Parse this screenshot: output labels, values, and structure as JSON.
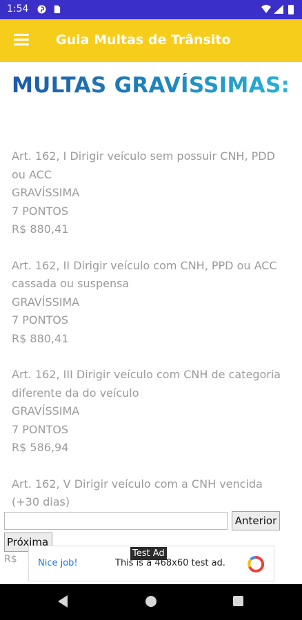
{
  "status_bar": {
    "time": "1:54",
    "icons": [
      "pinterest-icon",
      "sim-card-icon",
      "wifi-icon",
      "signal-icon",
      "battery-icon"
    ]
  },
  "app_bar": {
    "title": "Guia Multas de Trânsito",
    "menu_icon": "hamburger-menu-icon",
    "background_color": "#f7cd1b"
  },
  "content": {
    "heading": "MULTAS GRAVÍSSIMAS:",
    "entries": [
      {
        "article": "Art. 162, I Dirigir veículo sem possuir CNH, PDD ou ACC",
        "severity": "GRAVÍSSIMA",
        "points": "7 PONTOS",
        "value": "R$ 880,41"
      },
      {
        "article": "Art. 162, II Dirigir veículo com CNH, PPD ou ACC cassada ou suspensa",
        "severity": "GRAVÍSSIMA",
        "points": "7 PONTOS",
        "value": "R$ 880,41"
      },
      {
        "article": "Art. 162, III Dirigir veículo com CNH de categoria diferente da do veículo",
        "severity": "GRAVÍSSIMA",
        "points": "7 PONTOS",
        "value": "R$ 586,94"
      },
      {
        "article": "Art. 162, V Dirigir veículo com a CNH vencida (+30 dias)"
      }
    ],
    "partial_text": "R$"
  },
  "navigation": {
    "input_value": "",
    "previous_label": "Anterior",
    "next_label": "Próxima"
  },
  "ad": {
    "label": "Test Ad",
    "nice_job": "Nice job!",
    "text": "This is a 468x60 test ad.",
    "logo_icon": "admob-logo-icon"
  },
  "system_nav": {
    "icons": [
      "back-icon",
      "home-icon",
      "recents-icon"
    ]
  }
}
